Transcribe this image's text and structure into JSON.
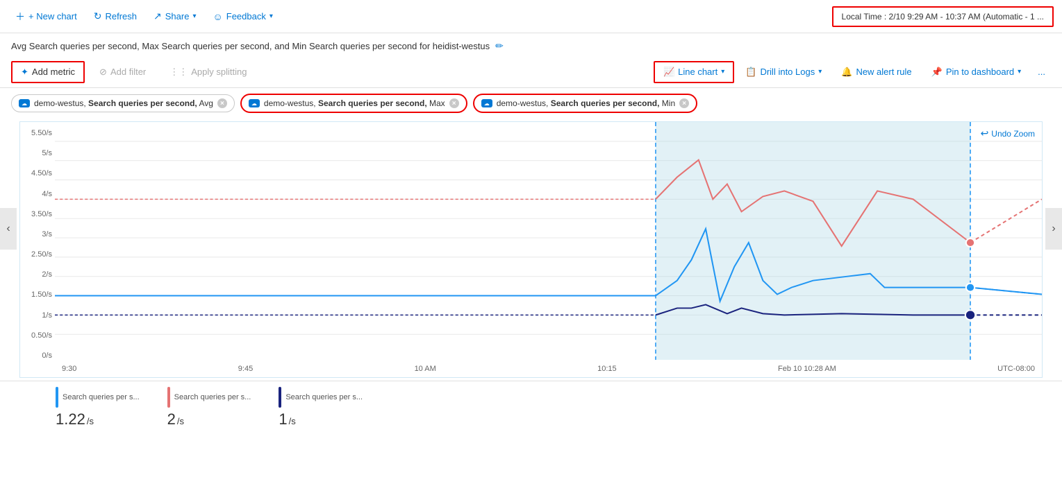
{
  "toolbar": {
    "new_chart": "+ New chart",
    "refresh": "Refresh",
    "share": "Share",
    "feedback": "Feedback",
    "time_range": "Local Time : 2/10 9:29 AM - 10:37 AM (Automatic - 1 ..."
  },
  "chart": {
    "title": "Avg Search queries per second, Max Search queries per second, and Min Search queries per second for heidist-westus",
    "edit_icon": "✏"
  },
  "metrics_toolbar": {
    "add_metric": "Add metric",
    "add_filter": "Add filter",
    "apply_splitting": "Apply splitting",
    "line_chart": "Line chart",
    "drill_into_logs": "Drill into Logs",
    "new_alert_rule": "New alert rule",
    "pin_to_dashboard": "Pin to dashboard",
    "more": "..."
  },
  "pills": [
    {
      "resource": "demo-westus",
      "metric": "Search queries per second",
      "agg": "Avg",
      "highlighted": false
    },
    {
      "resource": "demo-westus",
      "metric": "Search queries per second",
      "agg": "Max",
      "highlighted": true
    },
    {
      "resource": "demo-westus",
      "metric": "Search queries per second",
      "agg": "Min",
      "highlighted": true
    }
  ],
  "yaxis": {
    "labels": [
      "5.50/s",
      "5/s",
      "4.50/s",
      "4/s",
      "3.50/s",
      "3/s",
      "2.50/s",
      "2/s",
      "1.50/s",
      "1/s",
      "0.50/s",
      "0/s"
    ]
  },
  "xaxis": {
    "labels": [
      "9:30",
      "9:45",
      "10 AM",
      "10:15",
      "Feb 10 10:28 AM",
      "UTC-08:00"
    ]
  },
  "chart_controls": {
    "undo_zoom": "Undo Zoom"
  },
  "legend": [
    {
      "label": "Search queries per s...",
      "color": "#2196f3",
      "value": "1.22",
      "unit": "/s"
    },
    {
      "label": "Search queries per s...",
      "color": "#e57373",
      "value": "2",
      "unit": "/s"
    },
    {
      "label": "Search queries per s...",
      "color": "#1a237e",
      "value": "1",
      "unit": "/s"
    }
  ]
}
